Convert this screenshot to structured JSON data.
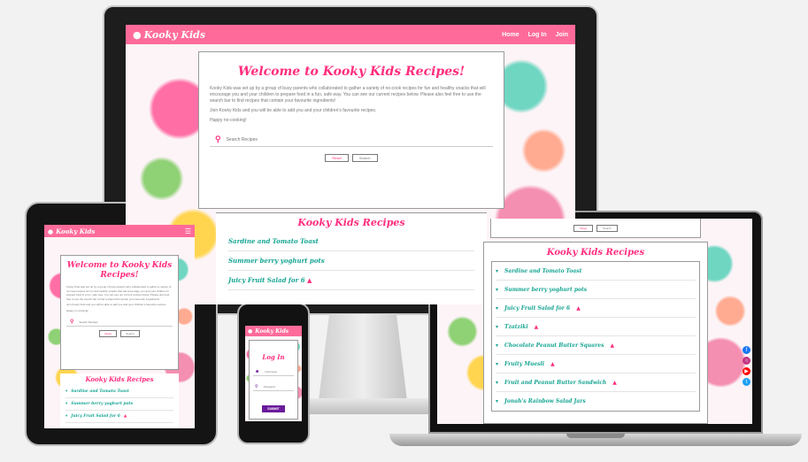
{
  "brand": "Kooky Kids",
  "nav": [
    "Home",
    "Log In",
    "Join"
  ],
  "hero": {
    "title": "Welcome to Kooky Kids Recipes!",
    "paragraph1": "Kooky Kids was set up by a group of busy parents who collaborated to gather a variety of no-cook recipes for fun and healthy snacks that will encourage you and your children to prepare food in a fun, safe way. You can see our current recipes below. Please also feel free to use the search bar to find recipes that contain your favourite ingredients!",
    "paragraph2": "Join Kooky Kids and you will be able to add you and your children's favourite recipes.",
    "paragraph3": "Happy no-cooking!",
    "search_placeholder": "Search Recipes",
    "search_button": "Search",
    "reset_button": "Reset"
  },
  "recipes_title": "Kooky Kids Recipes",
  "recipes": [
    {
      "name": "Sardine and Tomato Toast",
      "flame": false
    },
    {
      "name": "Summer berry yoghurt pots",
      "flame": false
    },
    {
      "name": "Juicy Fruit Salad for 6",
      "flame": true
    },
    {
      "name": "Tzatziki",
      "flame": true
    },
    {
      "name": "Chocolate Peanut Butter Squares",
      "flame": true
    },
    {
      "name": "Fruity Muesli",
      "flame": true
    },
    {
      "name": "Fruit and Peanut Butter Sandwich",
      "flame": true
    },
    {
      "name": "Jonah's Rainbow Salad Jars",
      "flame": false
    }
  ],
  "login": {
    "title": "Log In",
    "username_placeholder": "Username",
    "password_placeholder": "Password",
    "submit": "SUBMIT"
  },
  "colors": {
    "navbar": "#fe6b9a",
    "heading": "#ff2e7e",
    "recipe": "#16a592",
    "submit": "#6a1b9a"
  },
  "icons": [
    "cookie-icon",
    "search-icon",
    "user-icon",
    "key-icon",
    "flame-icon",
    "caret-icon",
    "facebook-icon",
    "instagram-icon",
    "youtube-icon",
    "twitter-icon"
  ]
}
